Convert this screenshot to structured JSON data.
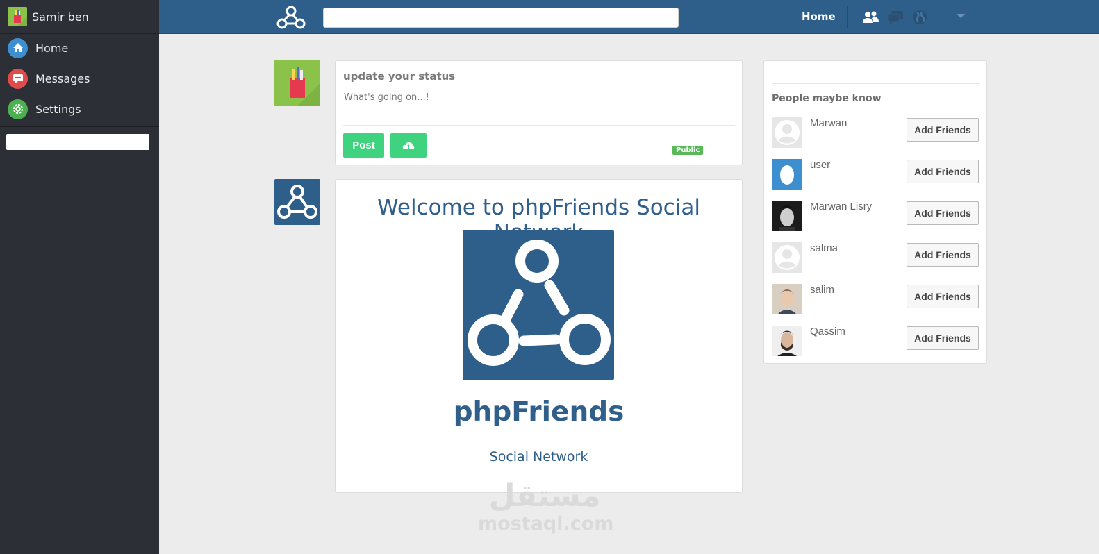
{
  "sidebar": {
    "user_name": "Samir ben",
    "items": [
      {
        "label": "Home",
        "icon": "home-icon",
        "color": "#3d8fd0"
      },
      {
        "label": "Messages",
        "icon": "messages-icon",
        "color": "#e04b4b"
      },
      {
        "label": "Settings",
        "icon": "gear-icon",
        "color": "#4caf50"
      }
    ]
  },
  "topbar": {
    "home_label": "Home",
    "icons": [
      "friends-icon",
      "chat-icon",
      "globe-icon"
    ]
  },
  "composer": {
    "title": "update your status",
    "placeholder": "What's going on...!",
    "post_label": "Post",
    "upload_icon": "cloud-upload-icon",
    "privacy_badge": "Public"
  },
  "welcome": {
    "heading": "Welcome to phpFriends Social Network",
    "brand": "phpFriends",
    "tagline": "Social Network"
  },
  "people": {
    "heading": "People maybe know",
    "button_label": "Add Friends",
    "list": [
      {
        "name": "Marwan",
        "avatar": "default"
      },
      {
        "name": "user",
        "avatar": "egg"
      },
      {
        "name": "Marwan Lisry",
        "avatar": "photo-dark"
      },
      {
        "name": "salma",
        "avatar": "default"
      },
      {
        "name": "salim",
        "avatar": "photo-light"
      },
      {
        "name": "Qassim",
        "avatar": "photo-beard"
      }
    ]
  },
  "watermark": {
    "arabic": "مستقل",
    "latin": "mostaql.com"
  },
  "colors": {
    "topbar": "#2e5e8a",
    "sidebar": "#2c2f35",
    "accent_green": "#3fd37f",
    "brand_blue": "#2f5f8a"
  }
}
